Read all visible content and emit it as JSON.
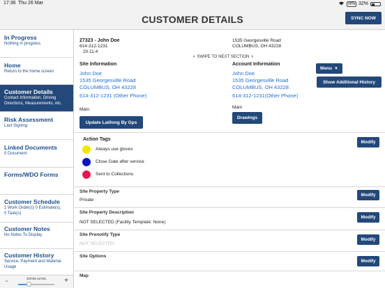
{
  "status_bar": {
    "time": "17:36",
    "date": "Thu 26 Mar",
    "vpn": "VPN",
    "battery": "32%",
    "battery_level": 0.32
  },
  "header": {
    "title": "CUSTOMER DETAILS",
    "sync_label": "SYNC NOW"
  },
  "sidebar": {
    "items": [
      {
        "title": "In Progress",
        "subtitle": "Nothing in progress"
      },
      {
        "title": "Home",
        "subtitle": "Return to the home screen"
      },
      {
        "title": "Customer Details",
        "subtitle": "Contact Information, Driving Directions, Measurements, etc."
      },
      {
        "title": "Risk Assessment",
        "subtitle": "Last Signing:"
      },
      {
        "title": "Linked Documents",
        "subtitle": "0 Document"
      },
      {
        "title": "Forms/WDO Forms",
        "subtitle": ""
      },
      {
        "title": "Customer Schedule",
        "subtitle": "1 Work Order(s) 0 Estimate(s), 0 Task(s)"
      },
      {
        "title": "Customer Notes",
        "subtitle": "No Notes To Display"
      },
      {
        "title": "Customer History",
        "subtitle": "Service, Payment and Material Usage"
      }
    ],
    "zoom": {
      "label": "ZOOM LEVEL",
      "minus": "-",
      "plus": "+",
      "level": 0.3
    }
  },
  "customer": {
    "id_name": "27323 - John Doe",
    "phone": "614-312-1231",
    "code": "20.11.4",
    "address_line1": "1535 Georgesville Road",
    "address_line2": "COLUMBUS, OH 43228"
  },
  "swipe_hint": "SWIPE TO NEXT SECTION",
  "site_info": {
    "heading": "Site Information",
    "name": "John Doe",
    "street": "1535 Georgesville Road",
    "city": "COLUMBUS, OH 43228",
    "phone": "614-312-1231 (Other Phone)",
    "type": "Main",
    "button": "Update Lat/long By Gps"
  },
  "account_info": {
    "heading": "Account Information",
    "name": "John Doe",
    "street": "1535 Georgesville Road",
    "city": "COLUMBUS, OH 43228",
    "phone": "614-312-1231(Other Phone)",
    "type": "Main",
    "button": "Drawings"
  },
  "menu_button": "Menu",
  "history_button": "Show Additional History",
  "action_tags": {
    "heading": "Action Tags",
    "tags": [
      {
        "label": "Always use gloves",
        "color": "#f2e600"
      },
      {
        "label": "Close Gate after service",
        "color": "#0a14c8"
      },
      {
        "label": "Sent to Collections",
        "color": "#e8164e"
      }
    ]
  },
  "modify_label": "Modify",
  "sections": [
    {
      "title": "Site Property Type",
      "value": "Private"
    },
    {
      "title": "Site Property Description",
      "value": "NOT SELECTED (Facility Template: None)"
    },
    {
      "title": "Site Prenotify Type",
      "value": "NOT SELECTED"
    },
    {
      "title": "Site Options",
      "value": ""
    },
    {
      "title": "Map",
      "value": ""
    }
  ],
  "colors": {
    "brand": "#23487a",
    "link": "#1e6fd0"
  }
}
